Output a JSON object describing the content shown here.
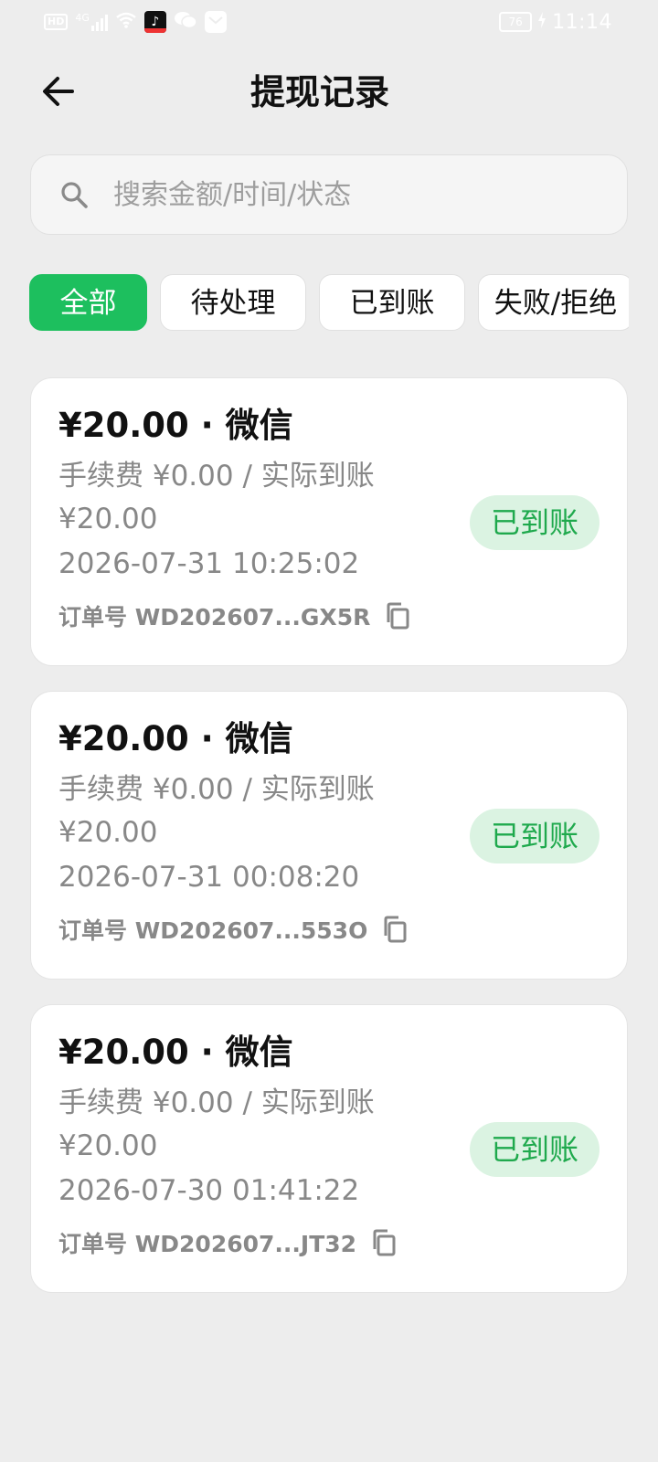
{
  "status_bar": {
    "hd": "HD",
    "network": "4G",
    "app_glyph": "♪",
    "battery": "76",
    "time": "11:14"
  },
  "header": {
    "title": "提现记录"
  },
  "search": {
    "placeholder": "搜索金额/时间/状态"
  },
  "tabs": [
    {
      "label": "全部",
      "active": true
    },
    {
      "label": "待处理",
      "active": false
    },
    {
      "label": "已到账",
      "active": false
    },
    {
      "label": "失败/拒绝",
      "active": false
    }
  ],
  "records": [
    {
      "title": "¥20.00 · 微信",
      "fee_line": "手续费 ¥0.00 / 实际到账 ¥20.00",
      "time": "2026-07-31 10:25:02",
      "order": "订单号 WD202607...GX5R",
      "status": "已到账"
    },
    {
      "title": "¥20.00 · 微信",
      "fee_line": "手续费 ¥0.00 / 实际到账 ¥20.00",
      "time": "2026-07-31 00:08:20",
      "order": "订单号 WD202607...553O",
      "status": "已到账"
    },
    {
      "title": "¥20.00 · 微信",
      "fee_line": "手续费 ¥0.00 / 实际到账 ¥20.00",
      "time": "2026-07-30 01:41:22",
      "order": "订单号 WD202607...JT32",
      "status": "已到账"
    }
  ],
  "colors": {
    "accent": "#1dbf5e",
    "success_text": "#1fa94d",
    "success_bg": "#dbf3e2",
    "background": "#ededed"
  }
}
